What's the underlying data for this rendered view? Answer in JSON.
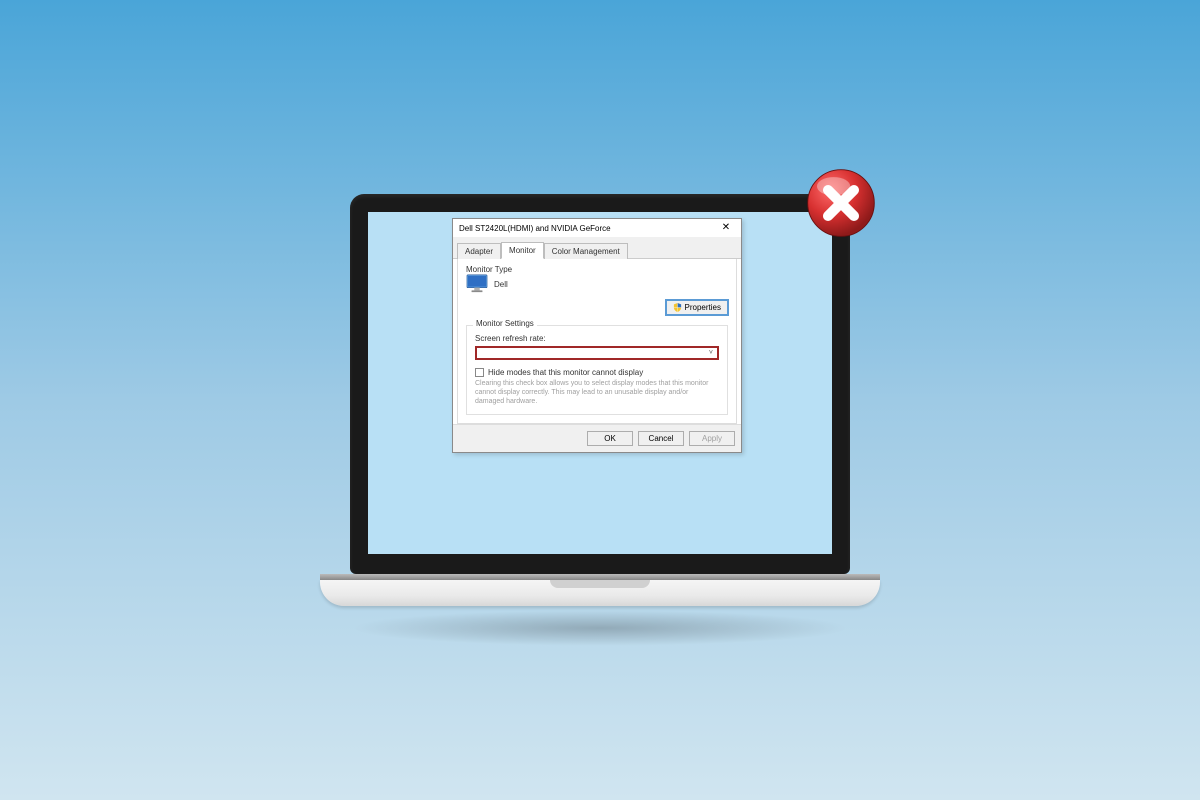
{
  "dialog": {
    "title": "Dell ST2420L(HDMI) and NVIDIA GeForce",
    "tabs": {
      "adapter": "Adapter",
      "monitor": "Monitor",
      "color": "Color Management"
    },
    "monitor_type_label": "Monitor Type",
    "monitor_name": "Dell",
    "properties_btn": "Properties",
    "settings_legend": "Monitor Settings",
    "refresh_label": "Screen refresh rate:",
    "hide_modes_label": "Hide modes that this monitor cannot display",
    "help_text": "Clearing this check box allows you to select display modes that this monitor cannot display correctly. This may lead to an unusable display and/or damaged hardware.",
    "ok": "OK",
    "cancel": "Cancel",
    "apply": "Apply"
  },
  "icons": {
    "close": "✕",
    "caret": "˅"
  }
}
